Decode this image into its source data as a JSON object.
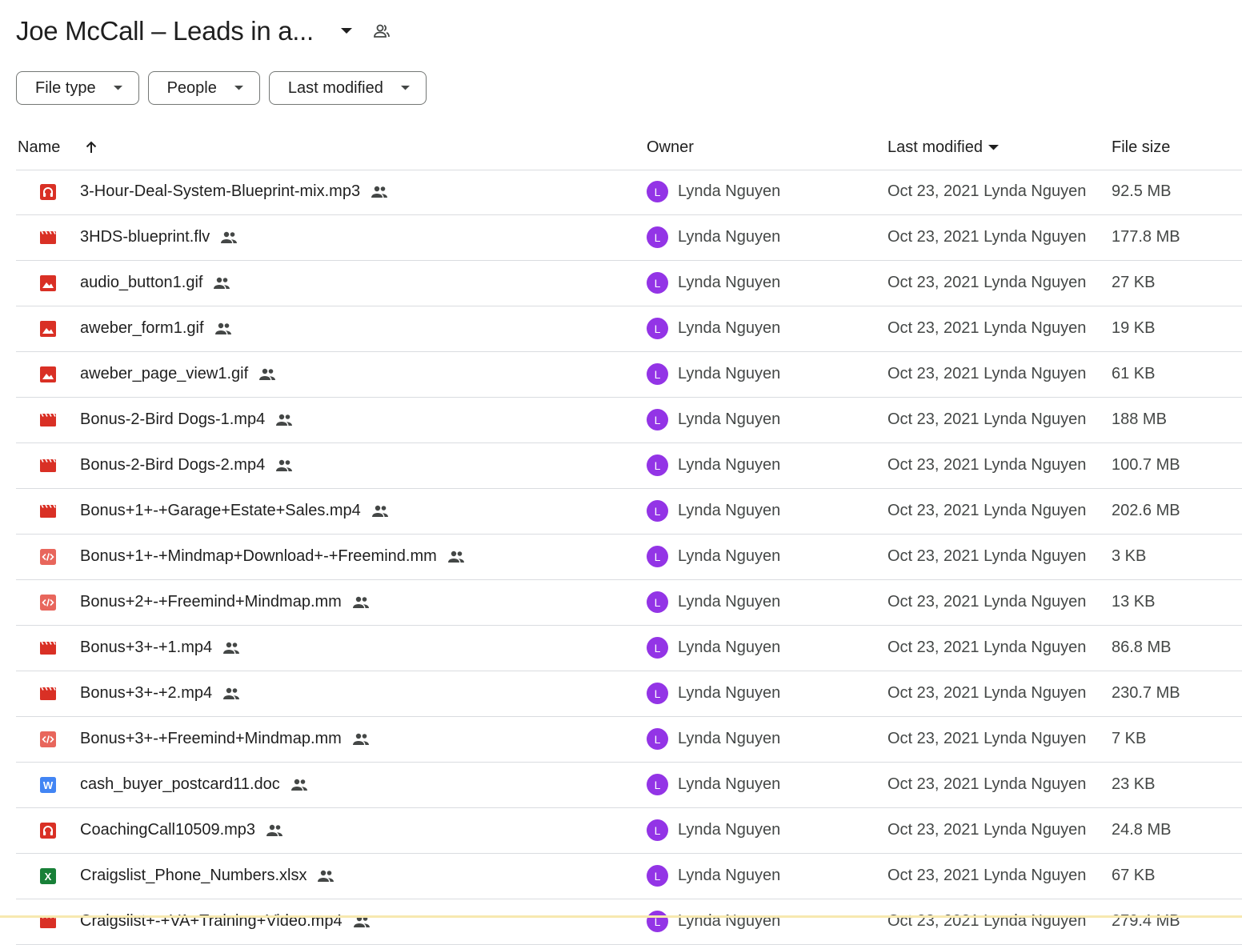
{
  "folder": {
    "title": "Joe McCall – Leads in a..."
  },
  "filters": [
    {
      "label": "File type"
    },
    {
      "label": "People"
    },
    {
      "label": "Last modified"
    }
  ],
  "columns": {
    "name": "Name",
    "owner": "Owner",
    "modified": "Last modified",
    "size": "File size"
  },
  "colors": {
    "audio": "#d93025",
    "video": "#d93025",
    "image": "#d93025",
    "code": "#e8665c",
    "word": "#4285f4",
    "excel": "#188038",
    "avatar": "#9334e6"
  },
  "rows": [
    {
      "name": "3-Hour-Deal-System-Blueprint-mix.mp3",
      "icon": "audio-file-icon",
      "owner_initial": "L",
      "owner": "Lynda Nguyen",
      "modified": "Oct 23, 2021 Lynda Nguyen",
      "size": "92.5 MB"
    },
    {
      "name": "3HDS-blueprint.flv",
      "icon": "video-file-icon",
      "owner_initial": "L",
      "owner": "Lynda Nguyen",
      "modified": "Oct 23, 2021 Lynda Nguyen",
      "size": "177.8 MB"
    },
    {
      "name": "audio_button1.gif",
      "icon": "image-file-icon",
      "owner_initial": "L",
      "owner": "Lynda Nguyen",
      "modified": "Oct 23, 2021 Lynda Nguyen",
      "size": "27 KB"
    },
    {
      "name": "aweber_form1.gif",
      "icon": "image-file-icon",
      "owner_initial": "L",
      "owner": "Lynda Nguyen",
      "modified": "Oct 23, 2021 Lynda Nguyen",
      "size": "19 KB"
    },
    {
      "name": "aweber_page_view1.gif",
      "icon": "image-file-icon",
      "owner_initial": "L",
      "owner": "Lynda Nguyen",
      "modified": "Oct 23, 2021 Lynda Nguyen",
      "size": "61 KB"
    },
    {
      "name": "Bonus-2-Bird Dogs-1.mp4",
      "icon": "video-file-icon",
      "owner_initial": "L",
      "owner": "Lynda Nguyen",
      "modified": "Oct 23, 2021 Lynda Nguyen",
      "size": "188 MB"
    },
    {
      "name": "Bonus-2-Bird Dogs-2.mp4",
      "icon": "video-file-icon",
      "owner_initial": "L",
      "owner": "Lynda Nguyen",
      "modified": "Oct 23, 2021 Lynda Nguyen",
      "size": "100.7 MB"
    },
    {
      "name": "Bonus+1+-+Garage+Estate+Sales.mp4",
      "icon": "video-file-icon",
      "owner_initial": "L",
      "owner": "Lynda Nguyen",
      "modified": "Oct 23, 2021 Lynda Nguyen",
      "size": "202.6 MB"
    },
    {
      "name": "Bonus+1+-+Mindmap+Download+-+Freemind.mm",
      "icon": "code-file-icon",
      "owner_initial": "L",
      "owner": "Lynda Nguyen",
      "modified": "Oct 23, 2021 Lynda Nguyen",
      "size": "3 KB"
    },
    {
      "name": "Bonus+2+-+Freemind+Mindmap.mm",
      "icon": "code-file-icon",
      "owner_initial": "L",
      "owner": "Lynda Nguyen",
      "modified": "Oct 23, 2021 Lynda Nguyen",
      "size": "13 KB"
    },
    {
      "name": "Bonus+3+-+1.mp4",
      "icon": "video-file-icon",
      "owner_initial": "L",
      "owner": "Lynda Nguyen",
      "modified": "Oct 23, 2021 Lynda Nguyen",
      "size": "86.8 MB"
    },
    {
      "name": "Bonus+3+-+2.mp4",
      "icon": "video-file-icon",
      "owner_initial": "L",
      "owner": "Lynda Nguyen",
      "modified": "Oct 23, 2021 Lynda Nguyen",
      "size": "230.7 MB"
    },
    {
      "name": "Bonus+3+-+Freemind+Mindmap.mm",
      "icon": "code-file-icon",
      "owner_initial": "L",
      "owner": "Lynda Nguyen",
      "modified": "Oct 23, 2021 Lynda Nguyen",
      "size": "7 KB"
    },
    {
      "name": "cash_buyer_postcard11.doc",
      "icon": "word-file-icon",
      "owner_initial": "L",
      "owner": "Lynda Nguyen",
      "modified": "Oct 23, 2021 Lynda Nguyen",
      "size": "23 KB"
    },
    {
      "name": "CoachingCall10509.mp3",
      "icon": "audio-file-icon",
      "owner_initial": "L",
      "owner": "Lynda Nguyen",
      "modified": "Oct 23, 2021 Lynda Nguyen",
      "size": "24.8 MB"
    },
    {
      "name": "Craigslist_Phone_Numbers.xlsx",
      "icon": "excel-file-icon",
      "owner_initial": "L",
      "owner": "Lynda Nguyen",
      "modified": "Oct 23, 2021 Lynda Nguyen",
      "size": "67 KB"
    },
    {
      "name": "Craigslist+-+VA+Training+Video.mp4",
      "icon": "video-file-icon",
      "owner_initial": "L",
      "owner": "Lynda Nguyen",
      "modified": "Oct 23, 2021 Lynda Nguyen",
      "size": "279.4 MB"
    }
  ]
}
